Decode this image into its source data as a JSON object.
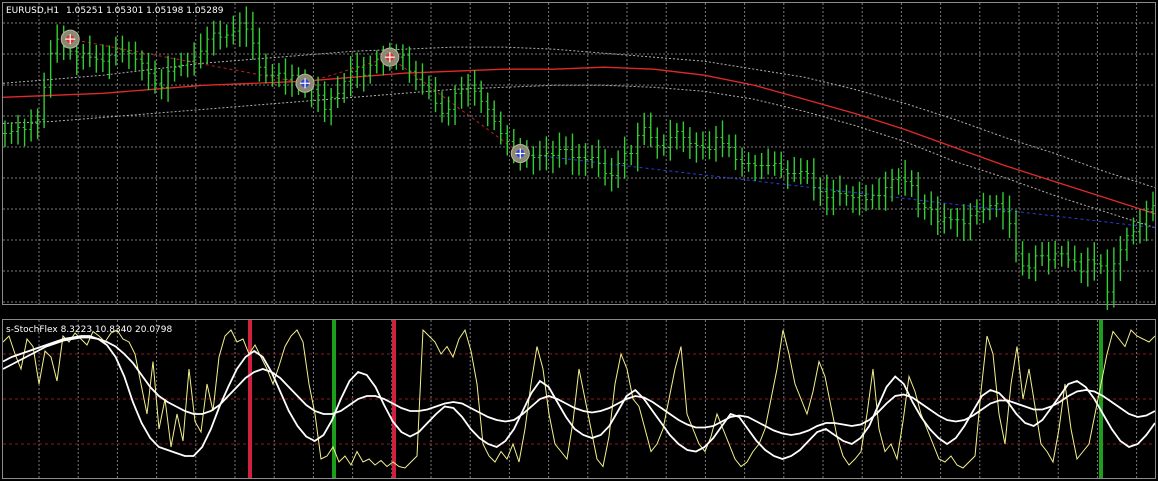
{
  "header": {
    "symbol_label": "EURUSD,H1",
    "ohlc_label": "1.05251 1.05301 1.05198 1.05289"
  },
  "indicator": {
    "label": "s-StochFlex 8.3223 10.8340 20.0798"
  },
  "colors": {
    "background": "#000000",
    "grid": "#7a7a7a",
    "candle": "#33cc33",
    "ma_red": "#e02a2a",
    "envelope": "#b0b0b0",
    "trend_blue": "#2a3ae0",
    "trend_red": "#c02020",
    "stoch_fast": "#f4f08a",
    "stoch_slow": "#ffffff",
    "signal_buy": "#1e9e1e",
    "signal_sell": "#d02040",
    "level_line": "#8a1a1a"
  },
  "chart_data": [
    {
      "type": "candlestick",
      "title": "EURUSD,H1",
      "series": [
        {
          "name": "price",
          "values": [
            1.0565,
            1.0566,
            1.0568,
            1.0567,
            1.057,
            1.0572,
            1.0588,
            1.0605,
            1.0612,
            1.0608,
            1.0606,
            1.0603,
            1.0605,
            1.0603,
            1.0602,
            1.0601,
            1.0604,
            1.0607,
            1.0606,
            1.0605,
            1.0602,
            1.06,
            1.0595,
            1.059,
            1.0588,
            1.0596,
            1.0598,
            1.0599,
            1.0601,
            1.0603,
            1.0606,
            1.0612,
            1.0615,
            1.0613,
            1.0614,
            1.0616,
            1.062,
            1.0617,
            1.061,
            1.0598,
            1.0594,
            1.0594,
            1.0595,
            1.0592,
            1.0594,
            1.059,
            1.0589,
            1.0587,
            1.0584,
            1.0577,
            1.0583,
            1.0585,
            1.0591,
            1.0596,
            1.0598,
            1.0594,
            1.0599,
            1.0602,
            1.0602,
            1.0601,
            1.0603,
            1.0604,
            1.0596,
            1.0592,
            1.0589,
            1.0586,
            1.058,
            1.0575,
            1.0577,
            1.0585,
            1.0587,
            1.0589,
            1.0586,
            1.0581,
            1.0577,
            1.0571,
            1.0565,
            1.0561,
            1.0556,
            1.0555,
            1.0554,
            1.0553,
            1.0554,
            1.0555,
            1.0554,
            1.0557,
            1.0557,
            1.0553,
            1.0553,
            1.0552,
            1.0553,
            1.055,
            1.0545,
            1.0544,
            1.055,
            1.0555,
            1.0555,
            1.0564,
            1.0568,
            1.0563,
            1.0559,
            1.0558,
            1.0563,
            1.0566,
            1.0563,
            1.056,
            1.0559,
            1.0558,
            1.0557,
            1.0563,
            1.056,
            1.0558,
            1.0552,
            1.055,
            1.055,
            1.0549,
            1.0549,
            1.0549,
            1.055,
            1.0547,
            1.0545,
            1.0545,
            1.0546,
            1.0545,
            1.0538,
            1.0536,
            1.0533,
            1.0536,
            1.0535,
            1.0534,
            1.0533,
            1.0534,
            1.0532,
            1.0534,
            1.0534,
            1.0538,
            1.0542,
            1.0543,
            1.0541,
            1.0539,
            1.053,
            1.0528,
            1.0527,
            1.0521,
            1.0523,
            1.0522,
            1.0522,
            1.052,
            1.0524,
            1.0526,
            1.0527,
            1.0529,
            1.053,
            1.0526,
            1.052,
            1.0505,
            1.0499,
            1.0498,
            1.0504,
            1.0504,
            1.0502,
            1.0505,
            1.0505,
            1.0502,
            1.0501,
            1.0496,
            1.0502,
            1.05,
            1.0499,
            1.0486,
            1.05,
            1.0507,
            1.0514,
            1.0516,
            1.052,
            1.0526,
            1.0529
          ]
        },
        {
          "name": "ma",
          "values": [
            1.0583,
            1.0584,
            1.0585,
            1.0587,
            1.0589,
            1.059,
            1.0591,
            1.0593,
            1.0595,
            1.0596,
            1.0597,
            1.0597,
            1.0598,
            1.0597,
            1.0594,
            1.0589,
            1.0582,
            1.0575,
            1.0567,
            1.0558,
            1.0549,
            1.0541,
            1.0533,
            1.0525
          ]
        },
        {
          "name": "envelope-upper",
          "values": [
            1.059,
            1.0592,
            1.0594,
            1.0597,
            1.06,
            1.0602,
            1.0604,
            1.0606,
            1.0607,
            1.0608,
            1.0608,
            1.0607,
            1.0605,
            1.0603,
            1.0601,
            1.0597,
            1.0593,
            1.0587,
            1.058,
            1.0572,
            1.0563,
            1.0555,
            1.0546,
            1.0538
          ]
        },
        {
          "name": "envelope-lower",
          "values": [
            1.057,
            1.0571,
            1.0573,
            1.0575,
            1.0577,
            1.0579,
            1.0581,
            1.0583,
            1.0585,
            1.0587,
            1.0588,
            1.0589,
            1.0589,
            1.0588,
            1.0586,
            1.0582,
            1.0576,
            1.0569,
            1.0561,
            1.0551,
            1.0543,
            1.0534,
            1.0526,
            1.0518
          ]
        }
      ],
      "signals": [
        {
          "type": "sell",
          "bar": 10,
          "price": 1.0612
        },
        {
          "type": "buy",
          "bar": 46,
          "price": 1.059
        },
        {
          "type": "sell",
          "bar": 59,
          "price": 1.0603
        },
        {
          "type": "buy",
          "bar": 79,
          "price": 1.0555
        }
      ],
      "ylim": [
        1.048,
        1.063
      ],
      "grid": true
    },
    {
      "type": "line",
      "title": "s-StochFlex",
      "series": [
        {
          "name": "fast",
          "values": [
            88,
            92,
            80,
            70,
            90,
            85,
            60,
            82,
            78,
            62,
            92,
            88,
            94,
            90,
            86,
            95,
            92,
            88,
            94,
            96,
            90,
            88,
            80,
            60,
            40,
            75,
            30,
            50,
            18,
            40,
            22,
            70,
            35,
            28,
            60,
            42,
            78,
            92,
            96,
            88,
            90,
            80,
            86,
            78,
            70,
            60,
            72,
            85,
            92,
            96,
            88,
            60,
            40,
            10,
            12,
            18,
            8,
            12,
            6,
            15,
            8,
            10,
            6,
            9,
            5,
            8,
            5,
            4,
            8,
            12,
            96,
            92,
            88,
            80,
            85,
            78,
            90,
            96,
            82,
            60,
            20,
            12,
            8,
            15,
            10,
            20,
            8,
            30,
            60,
            85,
            70,
            40,
            20,
            15,
            10,
            35,
            70,
            50,
            30,
            10,
            5,
            25,
            60,
            80,
            70,
            50,
            45,
            30,
            15,
            20,
            30,
            50,
            70,
            85,
            40,
            30,
            20,
            15,
            25,
            40,
            30,
            20,
            10,
            5,
            8,
            15,
            20,
            30,
            50,
            70,
            96,
            80,
            60,
            50,
            40,
            55,
            75,
            65,
            45,
            25,
            12,
            6,
            10,
            15,
            40,
            70,
            30,
            15,
            20,
            10,
            35,
            65,
            55,
            40,
            30,
            20,
            10,
            8,
            12,
            6,
            4,
            8,
            12,
            55,
            92,
            80,
            40,
            20,
            60,
            85,
            50,
            70,
            45,
            20,
            15,
            8,
            30,
            60,
            30,
            10,
            15,
            20,
            40,
            60,
            80,
            95,
            90,
            85,
            96,
            92,
            90,
            88,
            92
          ]
        },
        {
          "name": "mid",
          "values": [
            75,
            78,
            80,
            82,
            84,
            86,
            88,
            90,
            91,
            92,
            92,
            90,
            86,
            78,
            65,
            48,
            34,
            24,
            18,
            16,
            14,
            12,
            12,
            18,
            30,
            45,
            58,
            70,
            78,
            82,
            78,
            68,
            55,
            42,
            32,
            25,
            22,
            26,
            36,
            50,
            62,
            68,
            66,
            58,
            46,
            35,
            28,
            25,
            28,
            34,
            40,
            45,
            44,
            38,
            30,
            24,
            20,
            18,
            22,
            30,
            42,
            54,
            62,
            58,
            48,
            38,
            30,
            26,
            24,
            26,
            32,
            42,
            52,
            56,
            50,
            42,
            34,
            26,
            20,
            16,
            15,
            18,
            24,
            32,
            40,
            38,
            30,
            22,
            16,
            12,
            10,
            12,
            16,
            22,
            28,
            30,
            26,
            22,
            20,
            24,
            32,
            45,
            58,
            65,
            60,
            48,
            38,
            30,
            24,
            20,
            24,
            32,
            42,
            52,
            56,
            54,
            48,
            40,
            34,
            32,
            36,
            44,
            52,
            60,
            62,
            58,
            50,
            40,
            30,
            22,
            18,
            20,
            26,
            34
          ]
        },
        {
          "name": "slow",
          "values": [
            70,
            73,
            76,
            79,
            82,
            85,
            87,
            89,
            90,
            91,
            91,
            90,
            88,
            85,
            80,
            74,
            66,
            58,
            52,
            48,
            45,
            42,
            40,
            40,
            42,
            46,
            52,
            58,
            64,
            68,
            70,
            68,
            64,
            58,
            52,
            46,
            42,
            40,
            40,
            42,
            46,
            50,
            52,
            52,
            50,
            47,
            44,
            42,
            42,
            43,
            45,
            47,
            48,
            47,
            44,
            41,
            38,
            36,
            35,
            36,
            40,
            45,
            50,
            52,
            50,
            47,
            44,
            42,
            41,
            42,
            44,
            47,
            50,
            52,
            51,
            48,
            44,
            40,
            36,
            33,
            31,
            31,
            32,
            35,
            38,
            39,
            38,
            35,
            32,
            29,
            27,
            26,
            27,
            29,
            32,
            34,
            34,
            33,
            32,
            33,
            36,
            41,
            47,
            52,
            53,
            51,
            47,
            43,
            39,
            36,
            35,
            36,
            39,
            43,
            47,
            49,
            49,
            47,
            45,
            43,
            43,
            45,
            48,
            52,
            55,
            56,
            55,
            52,
            48,
            44,
            40,
            38,
            39,
            42
          ]
        }
      ],
      "signals": [
        {
          "type": "sell",
          "x": 250
        },
        {
          "type": "buy",
          "x": 334
        },
        {
          "type": "sell",
          "x": 394
        },
        {
          "type": "buy",
          "x": 1101
        }
      ],
      "levels": [
        80,
        50,
        20
      ],
      "ylim": [
        0,
        100
      ],
      "grid": true
    }
  ]
}
